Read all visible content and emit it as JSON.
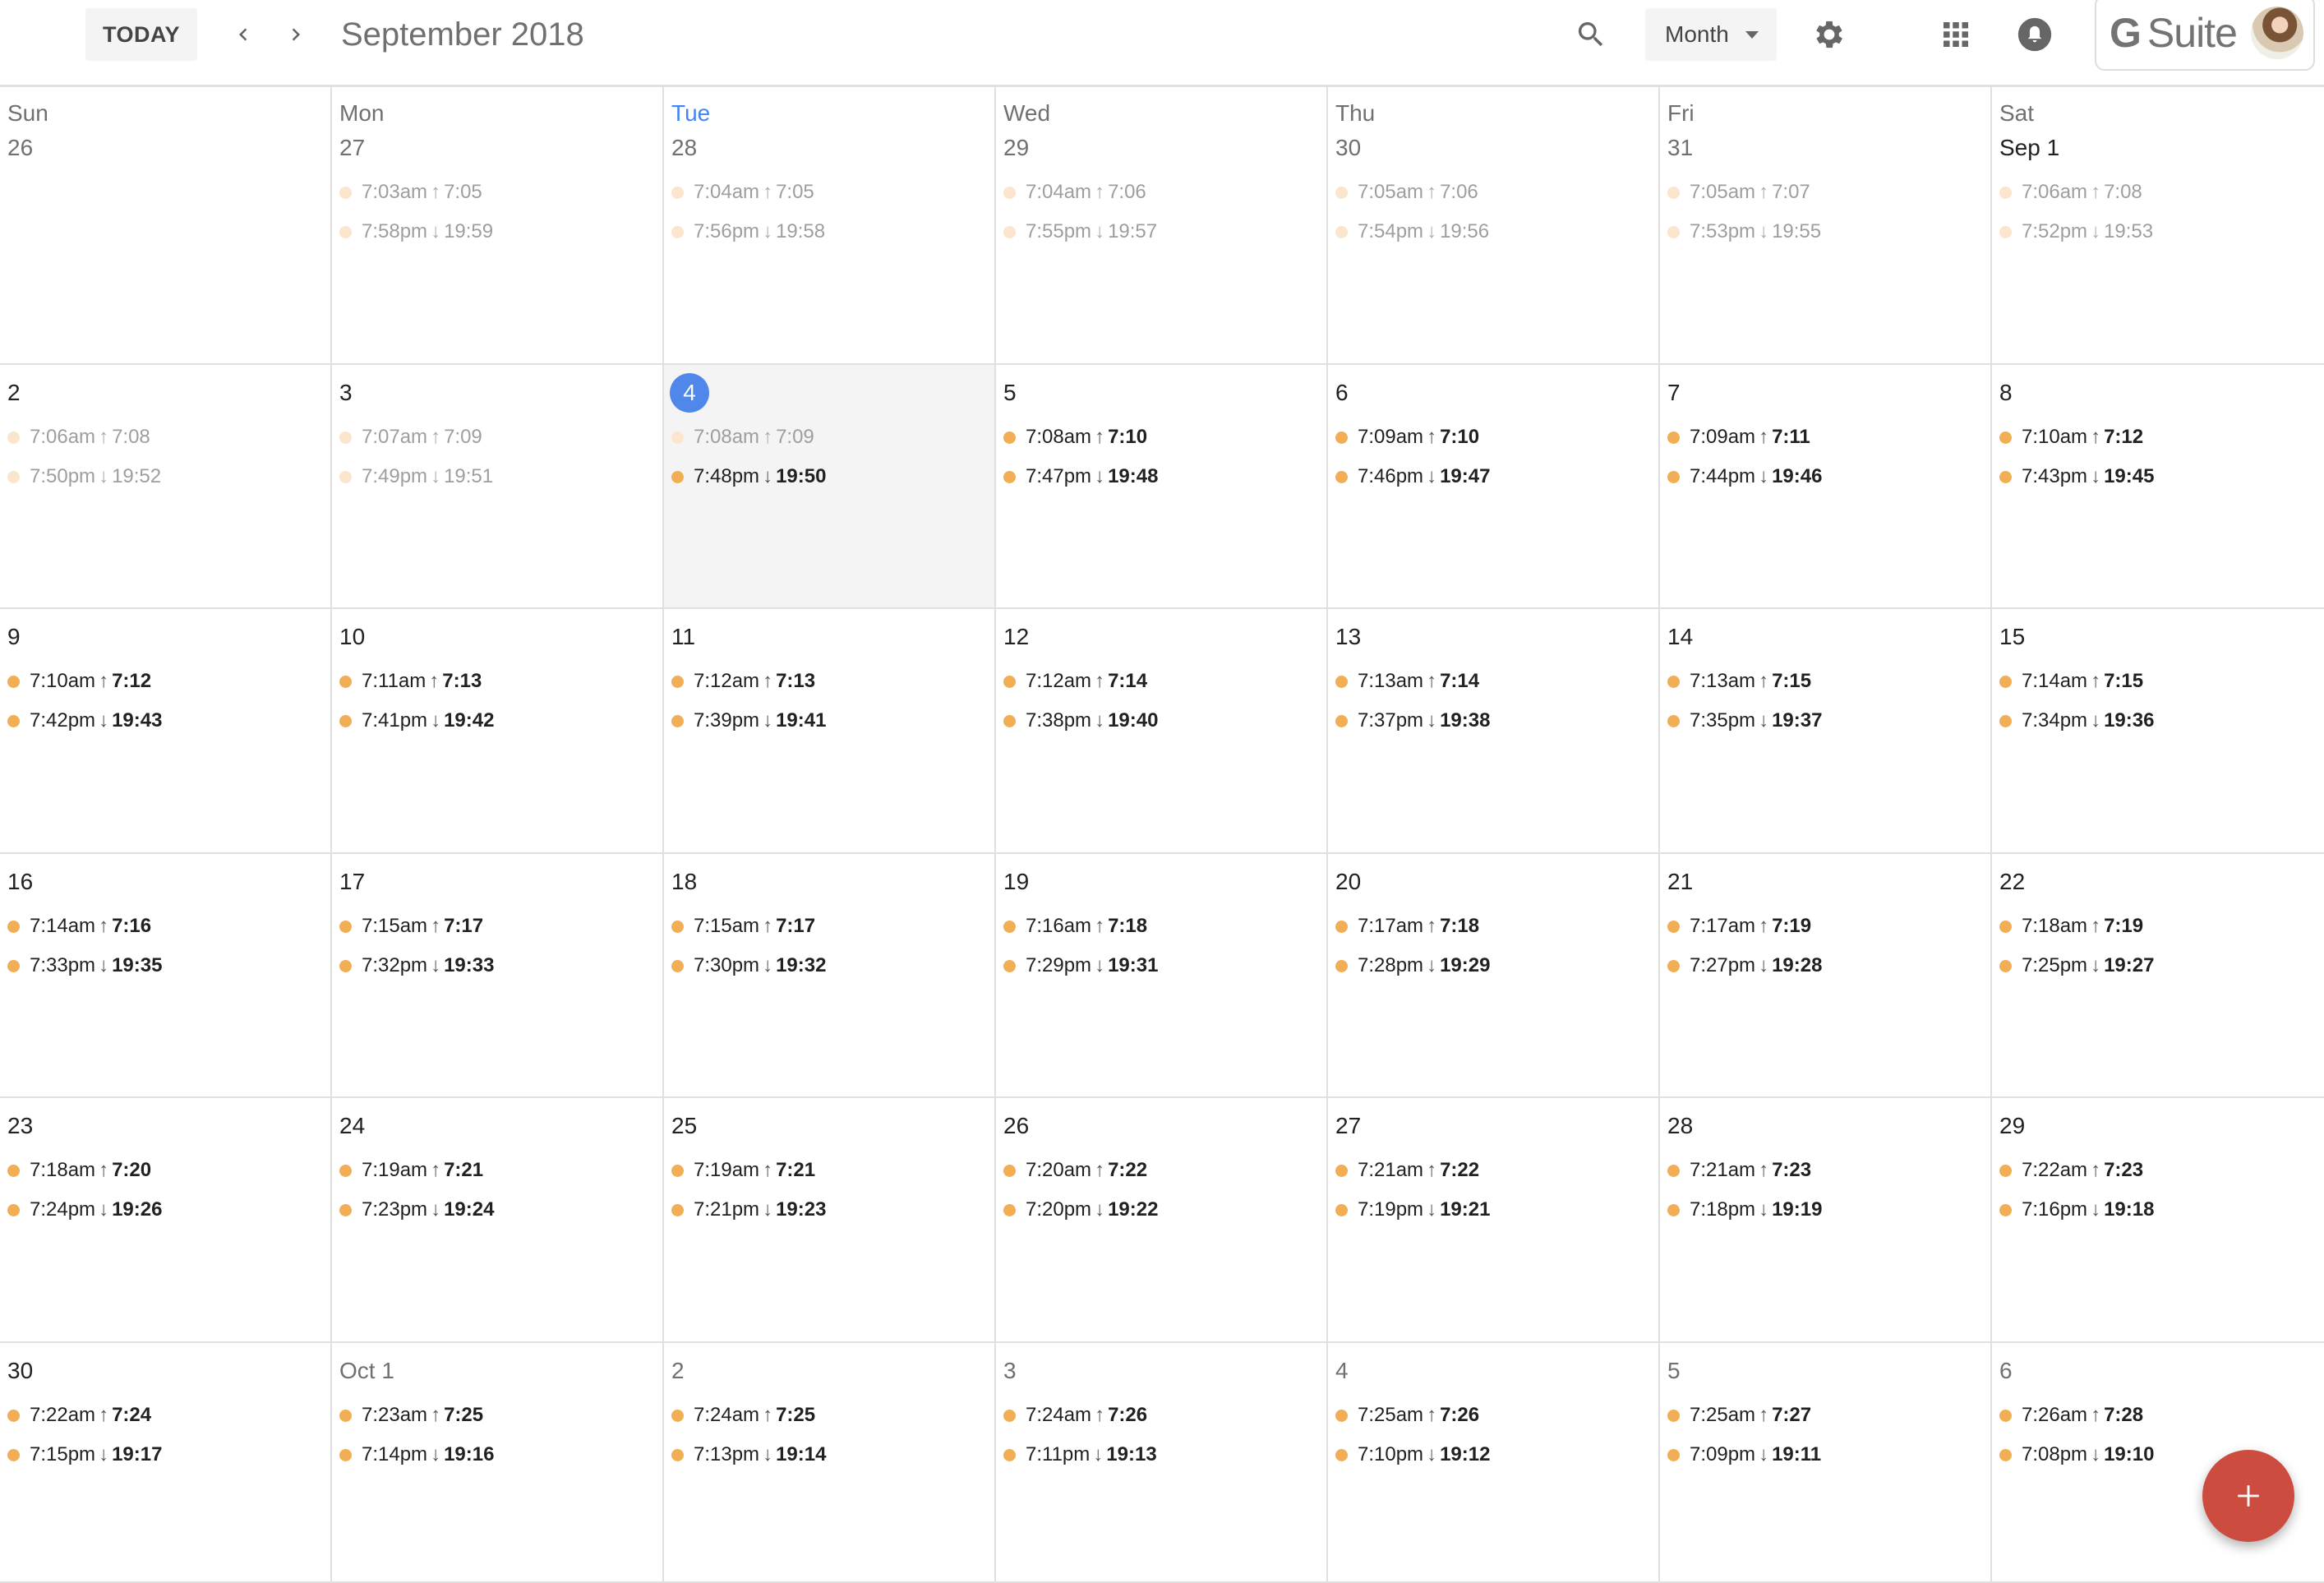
{
  "header": {
    "today_label": "TODAY",
    "prev_icon": "chevron-left-icon",
    "next_icon": "chevron-right-icon",
    "month_title": "September 2018",
    "search_icon": "search-icon",
    "view_selected": "Month",
    "settings_icon": "gear-icon",
    "apps_icon": "apps-grid-icon",
    "notifications_icon": "bell-icon",
    "brand": {
      "g": "G",
      "suite": "Suite"
    }
  },
  "colors": {
    "accent": "#4285f4",
    "today_circle": "#4f87ea",
    "event_dot": "#f2ae55",
    "event_dot_past": "#fbe5cc",
    "fab": "#cc4d3f",
    "today_bg": "#f4f4f4"
  },
  "weekdays": [
    "Sun",
    "Mon",
    "Tue",
    "Wed",
    "Thu",
    "Fri",
    "Sat"
  ],
  "today_weekday_index": 2,
  "weeks": [
    [
      {
        "label": "26",
        "other_month": true,
        "events": []
      },
      {
        "label": "27",
        "other_month": true,
        "events": [
          {
            "time": "7:03am",
            "arrow": "↑",
            "detail": "7:05",
            "past": true
          },
          {
            "time": "7:58pm",
            "arrow": "↓",
            "detail": "19:59",
            "past": true
          }
        ]
      },
      {
        "label": "28",
        "other_month": true,
        "events": [
          {
            "time": "7:04am",
            "arrow": "↑",
            "detail": "7:05",
            "past": true
          },
          {
            "time": "7:56pm",
            "arrow": "↓",
            "detail": "19:58",
            "past": true
          }
        ]
      },
      {
        "label": "29",
        "other_month": true,
        "events": [
          {
            "time": "7:04am",
            "arrow": "↑",
            "detail": "7:06",
            "past": true
          },
          {
            "time": "7:55pm",
            "arrow": "↓",
            "detail": "19:57",
            "past": true
          }
        ]
      },
      {
        "label": "30",
        "other_month": true,
        "events": [
          {
            "time": "7:05am",
            "arrow": "↑",
            "detail": "7:06",
            "past": true
          },
          {
            "time": "7:54pm",
            "arrow": "↓",
            "detail": "19:56",
            "past": true
          }
        ]
      },
      {
        "label": "31",
        "other_month": true,
        "events": [
          {
            "time": "7:05am",
            "arrow": "↑",
            "detail": "7:07",
            "past": true
          },
          {
            "time": "7:53pm",
            "arrow": "↓",
            "detail": "19:55",
            "past": true
          }
        ]
      },
      {
        "label": "Sep 1",
        "other_month": false,
        "events": [
          {
            "time": "7:06am",
            "arrow": "↑",
            "detail": "7:08",
            "past": true
          },
          {
            "time": "7:52pm",
            "arrow": "↓",
            "detail": "19:53",
            "past": true
          }
        ]
      }
    ],
    [
      {
        "label": "2",
        "events": [
          {
            "time": "7:06am",
            "arrow": "↑",
            "detail": "7:08",
            "past": true
          },
          {
            "time": "7:50pm",
            "arrow": "↓",
            "detail": "19:52",
            "past": true
          }
        ]
      },
      {
        "label": "3",
        "events": [
          {
            "time": "7:07am",
            "arrow": "↑",
            "detail": "7:09",
            "past": true
          },
          {
            "time": "7:49pm",
            "arrow": "↓",
            "detail": "19:51",
            "past": true
          }
        ]
      },
      {
        "label": "4",
        "today": true,
        "events": [
          {
            "time": "7:08am",
            "arrow": "↑",
            "detail": "7:09",
            "past": true
          },
          {
            "time": "7:48pm",
            "arrow": "↓",
            "detail": "19:50",
            "past": false
          }
        ]
      },
      {
        "label": "5",
        "events": [
          {
            "time": "7:08am",
            "arrow": "↑",
            "detail": "7:10"
          },
          {
            "time": "7:47pm",
            "arrow": "↓",
            "detail": "19:48"
          }
        ]
      },
      {
        "label": "6",
        "events": [
          {
            "time": "7:09am",
            "arrow": "↑",
            "detail": "7:10"
          },
          {
            "time": "7:46pm",
            "arrow": "↓",
            "detail": "19:47"
          }
        ]
      },
      {
        "label": "7",
        "events": [
          {
            "time": "7:09am",
            "arrow": "↑",
            "detail": "7:11"
          },
          {
            "time": "7:44pm",
            "arrow": "↓",
            "detail": "19:46"
          }
        ]
      },
      {
        "label": "8",
        "events": [
          {
            "time": "7:10am",
            "arrow": "↑",
            "detail": "7:12"
          },
          {
            "time": "7:43pm",
            "arrow": "↓",
            "detail": "19:45"
          }
        ]
      }
    ],
    [
      {
        "label": "9",
        "events": [
          {
            "time": "7:10am",
            "arrow": "↑",
            "detail": "7:12"
          },
          {
            "time": "7:42pm",
            "arrow": "↓",
            "detail": "19:43"
          }
        ]
      },
      {
        "label": "10",
        "events": [
          {
            "time": "7:11am",
            "arrow": "↑",
            "detail": "7:13"
          },
          {
            "time": "7:41pm",
            "arrow": "↓",
            "detail": "19:42"
          }
        ]
      },
      {
        "label": "11",
        "events": [
          {
            "time": "7:12am",
            "arrow": "↑",
            "detail": "7:13"
          },
          {
            "time": "7:39pm",
            "arrow": "↓",
            "detail": "19:41"
          }
        ]
      },
      {
        "label": "12",
        "events": [
          {
            "time": "7:12am",
            "arrow": "↑",
            "detail": "7:14"
          },
          {
            "time": "7:38pm",
            "arrow": "↓",
            "detail": "19:40"
          }
        ]
      },
      {
        "label": "13",
        "events": [
          {
            "time": "7:13am",
            "arrow": "↑",
            "detail": "7:14"
          },
          {
            "time": "7:37pm",
            "arrow": "↓",
            "detail": "19:38"
          }
        ]
      },
      {
        "label": "14",
        "events": [
          {
            "time": "7:13am",
            "arrow": "↑",
            "detail": "7:15"
          },
          {
            "time": "7:35pm",
            "arrow": "↓",
            "detail": "19:37"
          }
        ]
      },
      {
        "label": "15",
        "events": [
          {
            "time": "7:14am",
            "arrow": "↑",
            "detail": "7:15"
          },
          {
            "time": "7:34pm",
            "arrow": "↓",
            "detail": "19:36"
          }
        ]
      }
    ],
    [
      {
        "label": "16",
        "events": [
          {
            "time": "7:14am",
            "arrow": "↑",
            "detail": "7:16"
          },
          {
            "time": "7:33pm",
            "arrow": "↓",
            "detail": "19:35"
          }
        ]
      },
      {
        "label": "17",
        "events": [
          {
            "time": "7:15am",
            "arrow": "↑",
            "detail": "7:17"
          },
          {
            "time": "7:32pm",
            "arrow": "↓",
            "detail": "19:33"
          }
        ]
      },
      {
        "label": "18",
        "events": [
          {
            "time": "7:15am",
            "arrow": "↑",
            "detail": "7:17"
          },
          {
            "time": "7:30pm",
            "arrow": "↓",
            "detail": "19:32"
          }
        ]
      },
      {
        "label": "19",
        "events": [
          {
            "time": "7:16am",
            "arrow": "↑",
            "detail": "7:18"
          },
          {
            "time": "7:29pm",
            "arrow": "↓",
            "detail": "19:31"
          }
        ]
      },
      {
        "label": "20",
        "events": [
          {
            "time": "7:17am",
            "arrow": "↑",
            "detail": "7:18"
          },
          {
            "time": "7:28pm",
            "arrow": "↓",
            "detail": "19:29"
          }
        ]
      },
      {
        "label": "21",
        "events": [
          {
            "time": "7:17am",
            "arrow": "↑",
            "detail": "7:19"
          },
          {
            "time": "7:27pm",
            "arrow": "↓",
            "detail": "19:28"
          }
        ]
      },
      {
        "label": "22",
        "events": [
          {
            "time": "7:18am",
            "arrow": "↑",
            "detail": "7:19"
          },
          {
            "time": "7:25pm",
            "arrow": "↓",
            "detail": "19:27"
          }
        ]
      }
    ],
    [
      {
        "label": "23",
        "events": [
          {
            "time": "7:18am",
            "arrow": "↑",
            "detail": "7:20"
          },
          {
            "time": "7:24pm",
            "arrow": "↓",
            "detail": "19:26"
          }
        ]
      },
      {
        "label": "24",
        "events": [
          {
            "time": "7:19am",
            "arrow": "↑",
            "detail": "7:21"
          },
          {
            "time": "7:23pm",
            "arrow": "↓",
            "detail": "19:24"
          }
        ]
      },
      {
        "label": "25",
        "events": [
          {
            "time": "7:19am",
            "arrow": "↑",
            "detail": "7:21"
          },
          {
            "time": "7:21pm",
            "arrow": "↓",
            "detail": "19:23"
          }
        ]
      },
      {
        "label": "26",
        "events": [
          {
            "time": "7:20am",
            "arrow": "↑",
            "detail": "7:22"
          },
          {
            "time": "7:20pm",
            "arrow": "↓",
            "detail": "19:22"
          }
        ]
      },
      {
        "label": "27",
        "events": [
          {
            "time": "7:21am",
            "arrow": "↑",
            "detail": "7:22"
          },
          {
            "time": "7:19pm",
            "arrow": "↓",
            "detail": "19:21"
          }
        ]
      },
      {
        "label": "28",
        "events": [
          {
            "time": "7:21am",
            "arrow": "↑",
            "detail": "7:23"
          },
          {
            "time": "7:18pm",
            "arrow": "↓",
            "detail": "19:19"
          }
        ]
      },
      {
        "label": "29",
        "events": [
          {
            "time": "7:22am",
            "arrow": "↑",
            "detail": "7:23"
          },
          {
            "time": "7:16pm",
            "arrow": "↓",
            "detail": "19:18"
          }
        ]
      }
    ],
    [
      {
        "label": "30",
        "events": [
          {
            "time": "7:22am",
            "arrow": "↑",
            "detail": "7:24"
          },
          {
            "time": "7:15pm",
            "arrow": "↓",
            "detail": "19:17"
          }
        ]
      },
      {
        "label": "Oct 1",
        "other_month": true,
        "events": [
          {
            "time": "7:23am",
            "arrow": "↑",
            "detail": "7:25"
          },
          {
            "time": "7:14pm",
            "arrow": "↓",
            "detail": "19:16"
          }
        ]
      },
      {
        "label": "2",
        "other_month": true,
        "events": [
          {
            "time": "7:24am",
            "arrow": "↑",
            "detail": "7:25"
          },
          {
            "time": "7:13pm",
            "arrow": "↓",
            "detail": "19:14"
          }
        ]
      },
      {
        "label": "3",
        "other_month": true,
        "events": [
          {
            "time": "7:24am",
            "arrow": "↑",
            "detail": "7:26"
          },
          {
            "time": "7:11pm",
            "arrow": "↓",
            "detail": "19:13"
          }
        ]
      },
      {
        "label": "4",
        "other_month": true,
        "events": [
          {
            "time": "7:25am",
            "arrow": "↑",
            "detail": "7:26"
          },
          {
            "time": "7:10pm",
            "arrow": "↓",
            "detail": "19:12"
          }
        ]
      },
      {
        "label": "5",
        "other_month": true,
        "events": [
          {
            "time": "7:25am",
            "arrow": "↑",
            "detail": "7:27"
          },
          {
            "time": "7:09pm",
            "arrow": "↓",
            "detail": "19:11"
          }
        ]
      },
      {
        "label": "6",
        "other_month": true,
        "events": [
          {
            "time": "7:26am",
            "arrow": "↑",
            "detail": "7:28"
          },
          {
            "time": "7:08pm",
            "arrow": "↓",
            "detail": "19:10"
          }
        ]
      }
    ]
  ],
  "fab": {
    "icon": "plus-icon",
    "label": "+"
  }
}
